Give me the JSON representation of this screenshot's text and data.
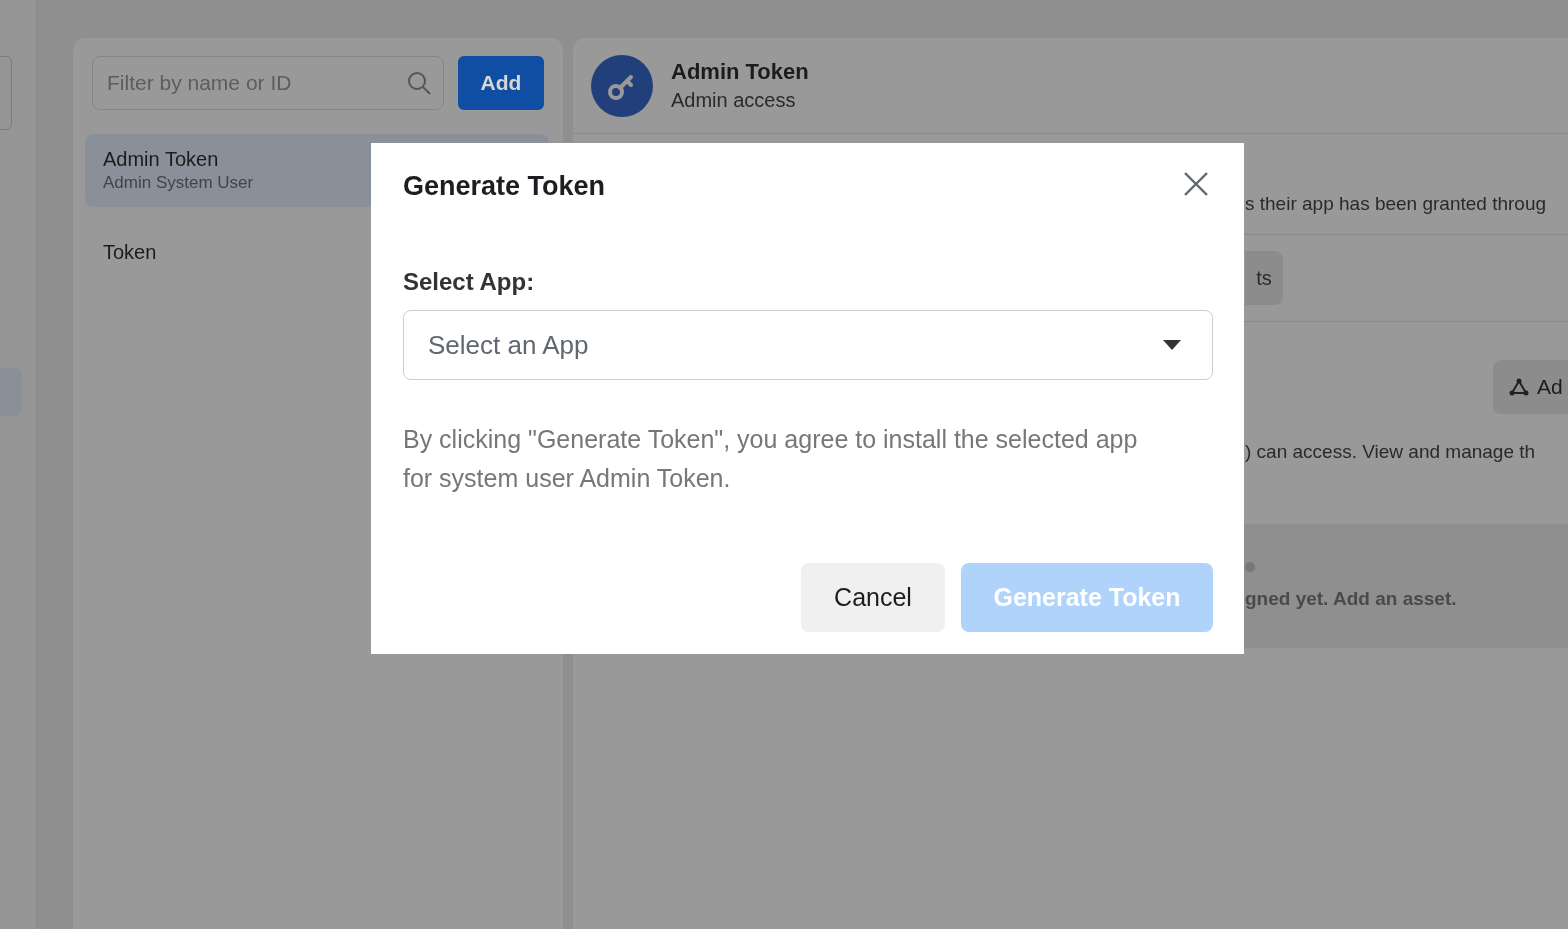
{
  "sidebar": {
    "search": {
      "placeholder": "Filter by name or ID"
    },
    "add_button": "Add",
    "items": [
      {
        "title": "Admin Token",
        "subtitle": "Admin System User",
        "selected": true
      },
      {
        "title": "Token",
        "selected": false
      }
    ]
  },
  "detail": {
    "title": "Admin Token",
    "subtitle": "Admin access",
    "background_fragments": {
      "permissions_text": "s their app has been granted throug",
      "button_fragment": "ts",
      "add_assets_button": "Ad",
      "assets_text": ") can access. View and manage th",
      "empty_text": "gned yet. Add an asset."
    }
  },
  "dialog": {
    "title": "Generate Token",
    "field_label": "Select App:",
    "select": {
      "placeholder": "Select an App"
    },
    "notice": "By clicking \"Generate Token\", you agree to install the selected app for system user Admin Token.",
    "buttons": [
      {
        "label": "Cancel",
        "kind": "secondary",
        "disabled": false
      },
      {
        "label": "Generate Token",
        "kind": "primary",
        "disabled": true
      }
    ]
  }
}
